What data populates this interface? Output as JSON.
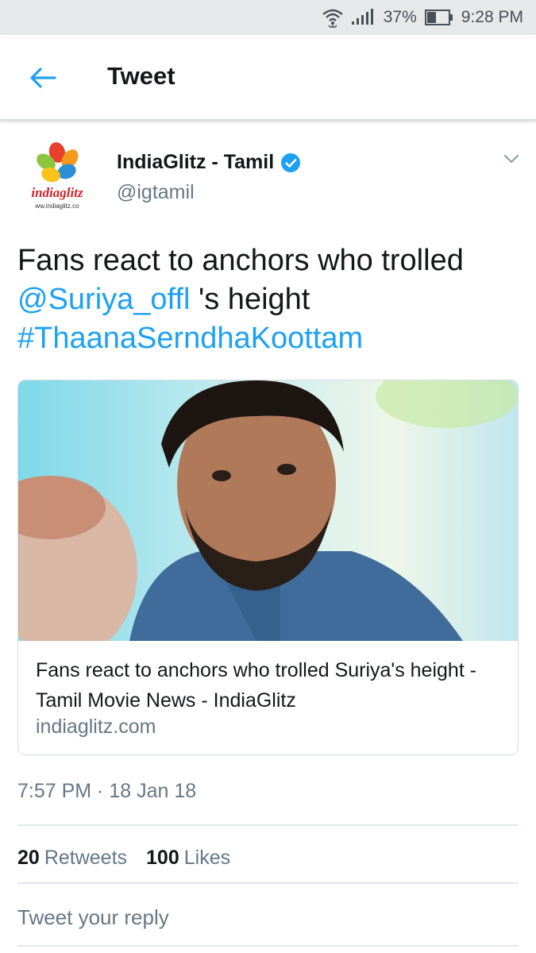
{
  "status_bar": {
    "battery_percent": "37%",
    "time": "9:28 PM",
    "icons": [
      "wifi-icon",
      "signal-icon",
      "battery-icon"
    ]
  },
  "app_bar": {
    "title": "Tweet",
    "back_icon": "arrow-left-icon"
  },
  "tweet": {
    "author": {
      "name": "IndiaGlitz - Tamil",
      "handle": "@igtamil",
      "verified": true,
      "avatar_text": "indiaglitz",
      "avatar_subtext": "ww.indiaglitz.co"
    },
    "text_parts": {
      "p1": "Fans react to anchors who trolled ",
      "mention": "@Suriya_offl",
      "p2": " 's height ",
      "hashtag": "#ThaanaSerndhaKoottam"
    },
    "card": {
      "title": "Fans react to anchors who trolled Suriya's height - Tamil Movie News - IndiaGlitz",
      "domain": "indiaglitz.com"
    },
    "timestamp": "7:57 PM · 18 Jan 18",
    "retweets_count": "20",
    "retweets_label": "Retweets",
    "likes_count": "100",
    "likes_label": "Likes"
  },
  "reply": {
    "placeholder": "Tweet your reply"
  },
  "colors": {
    "accent": "#1da1f2",
    "text": "#14171a",
    "secondary": "#657786",
    "status_bar_bg": "#e6e8ea"
  }
}
